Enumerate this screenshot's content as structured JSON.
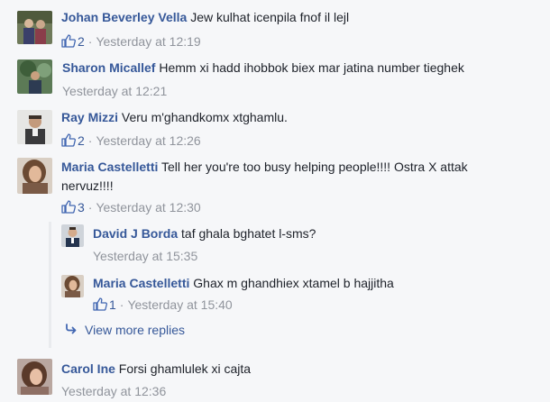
{
  "comments": [
    {
      "name": "Johan Beverley Vella",
      "text": "Jew kulhat icenpila fnof il lejl",
      "likes": "2",
      "time": "Yesterday at 12:19"
    },
    {
      "name": "Sharon Micallef",
      "text": "Hemm xi hadd ihobbok biex mar jatina number tieghek",
      "time": "Yesterday at 12:21"
    },
    {
      "name": "Ray Mizzi",
      "text": "Veru m'ghandkomx xtghamlu.",
      "likes": "2",
      "time": "Yesterday at 12:26"
    },
    {
      "name": "Maria Castelletti",
      "text": "Tell her you're too busy helping people!!!! Ostra X attak",
      "text2": "nervuz!!!!",
      "likes": "3",
      "time": "Yesterday at 12:30"
    },
    {
      "name": "Carol Ine",
      "text": "Forsi ghamlulek xi cajta",
      "time": "Yesterday at 12:36"
    }
  ],
  "replies": [
    {
      "name": "David J Borda",
      "text": "taf ghala bghatet l-sms?",
      "time": "Yesterday at 15:35"
    },
    {
      "name": "Maria Castelletti",
      "text": "Ghax m ghandhiex xtamel b hajjitha",
      "likes": "1",
      "time": "Yesterday at 15:40"
    }
  ],
  "view_more_replies": "View more replies",
  "separator": "·",
  "icons": {
    "like": "like-thumb-icon",
    "reply_arrow": "reply-arrow-icon"
  },
  "colors": {
    "name_link": "#365899",
    "meta": "#90949c",
    "background": "#f6f7f9"
  }
}
